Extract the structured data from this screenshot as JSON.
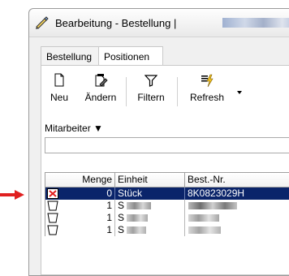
{
  "window": {
    "title": "Bearbeitung - Bestellung |"
  },
  "tabs": [
    {
      "label": "Bestellung",
      "active": false
    },
    {
      "label": "Positionen",
      "active": true
    }
  ],
  "toolbar": {
    "new_label": "Neu",
    "edit_label": "Ändern",
    "filter_label": "Filtern",
    "refresh_label": "Refresh"
  },
  "filter": {
    "label": "Mitarbeiter ▼",
    "value": ""
  },
  "grid": {
    "columns": [
      "Menge",
      "Einheit",
      "Best.-Nr."
    ],
    "rows": [
      {
        "menge": "0",
        "einheit": "Stück",
        "best_nr": "8K0823029H",
        "selected": true,
        "status": "cancelled-cup-icon"
      },
      {
        "menge": "1",
        "einheit": "S",
        "best_nr": "",
        "selected": false,
        "status": "cup-icon"
      },
      {
        "menge": "1",
        "einheit": "S",
        "best_nr": "",
        "selected": false,
        "status": "cup-icon"
      },
      {
        "menge": "1",
        "einheit": "S",
        "best_nr": "",
        "selected": false,
        "status": "cup-icon"
      }
    ]
  },
  "colors": {
    "selection": "#0a246a",
    "accent_arrow": "#e02020",
    "status_red": "#e02020"
  }
}
